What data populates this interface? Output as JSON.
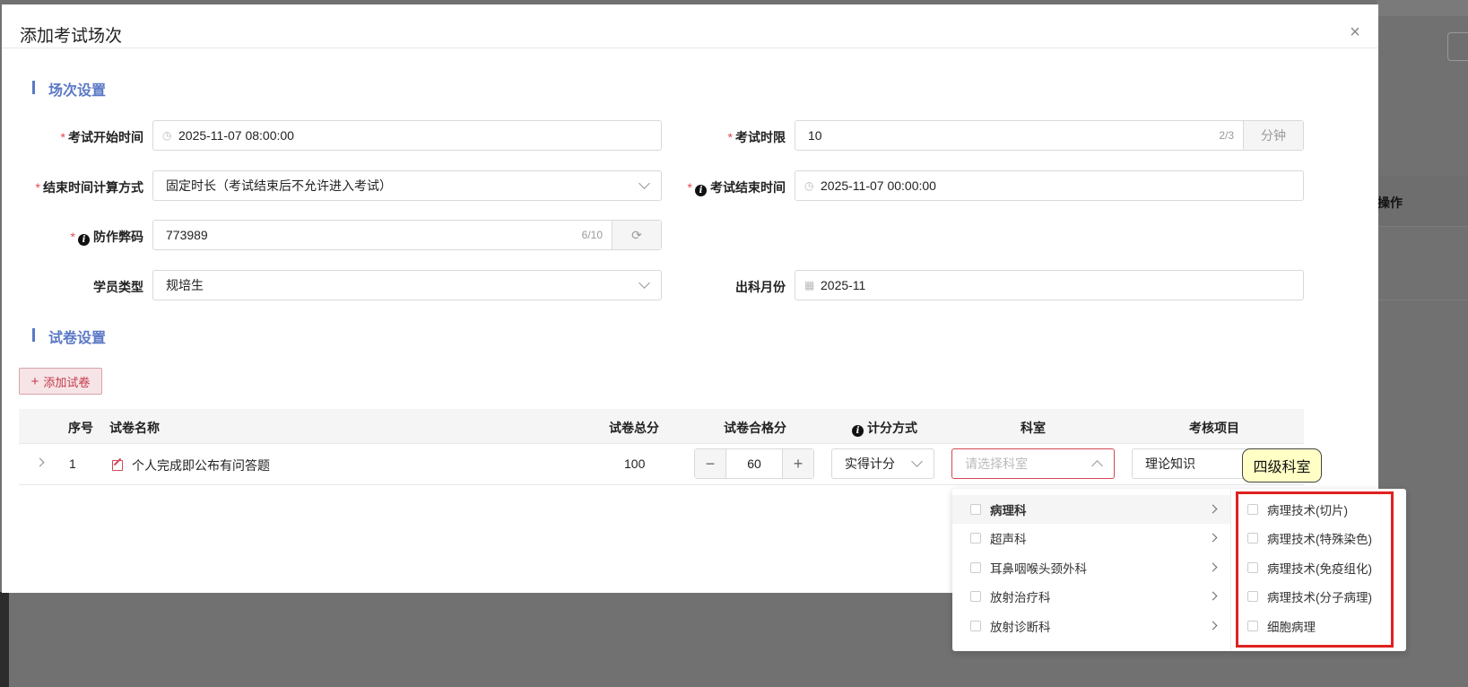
{
  "background": {
    "column_header": "操作"
  },
  "dialog": {
    "title": "添加考试场次",
    "close_icon": "close-icon",
    "section_session": "场次设置",
    "section_paper": "试卷设置"
  },
  "form": {
    "start_time": {
      "label": "考试开始时间",
      "value": "2025-11-07 08:00:00",
      "required": true
    },
    "duration": {
      "label": "考试时限",
      "value": "10",
      "count": "2/3",
      "unit": "分钟",
      "required": true
    },
    "end_calc": {
      "label": "结束时间计算方式",
      "value": "固定时长（考试结束后不允许进入考试）",
      "required": true
    },
    "end_time": {
      "label": "考试结束时间",
      "value": "2025-11-07 00:00:00",
      "required": true
    },
    "anti_cheat": {
      "label": "防作弊码",
      "value": "773989",
      "count": "6/10",
      "required": true
    },
    "student_type": {
      "label": "学员类型",
      "value": "规培生"
    },
    "exit_month": {
      "label": "出科月份",
      "value": "2025-11"
    }
  },
  "add_paper_button": "添加试卷",
  "table": {
    "headers": {
      "index": "序号",
      "name": "试卷名称",
      "total": "试卷总分",
      "pass": "试卷合格分",
      "scoring": "计分方式",
      "dept": "科室",
      "item": "考核项目"
    },
    "rows": [
      {
        "index": "1",
        "name": "个人完成即公布有问答题",
        "total": "100",
        "pass": "60",
        "scoring": "实得计分",
        "dept_placeholder": "请选择科室",
        "item": "理论知识"
      }
    ]
  },
  "dropdown": {
    "level1": [
      {
        "label": "病理科",
        "active": true
      },
      {
        "label": "超声科"
      },
      {
        "label": "耳鼻咽喉头颈外科"
      },
      {
        "label": "放射治疗科"
      },
      {
        "label": "放射诊断科"
      }
    ],
    "level2": [
      {
        "label": "病理技术(切片)"
      },
      {
        "label": "病理技术(特殊染色)"
      },
      {
        "label": "病理技术(免疫组化)"
      },
      {
        "label": "病理技术(分子病理)"
      },
      {
        "label": "细胞病理"
      }
    ]
  },
  "annotation": {
    "callout": "四级科室",
    "box_color": "#e02020"
  },
  "colors": {
    "accent": "#5b78c6",
    "danger": "#c2394a",
    "required": "#e5484d"
  }
}
